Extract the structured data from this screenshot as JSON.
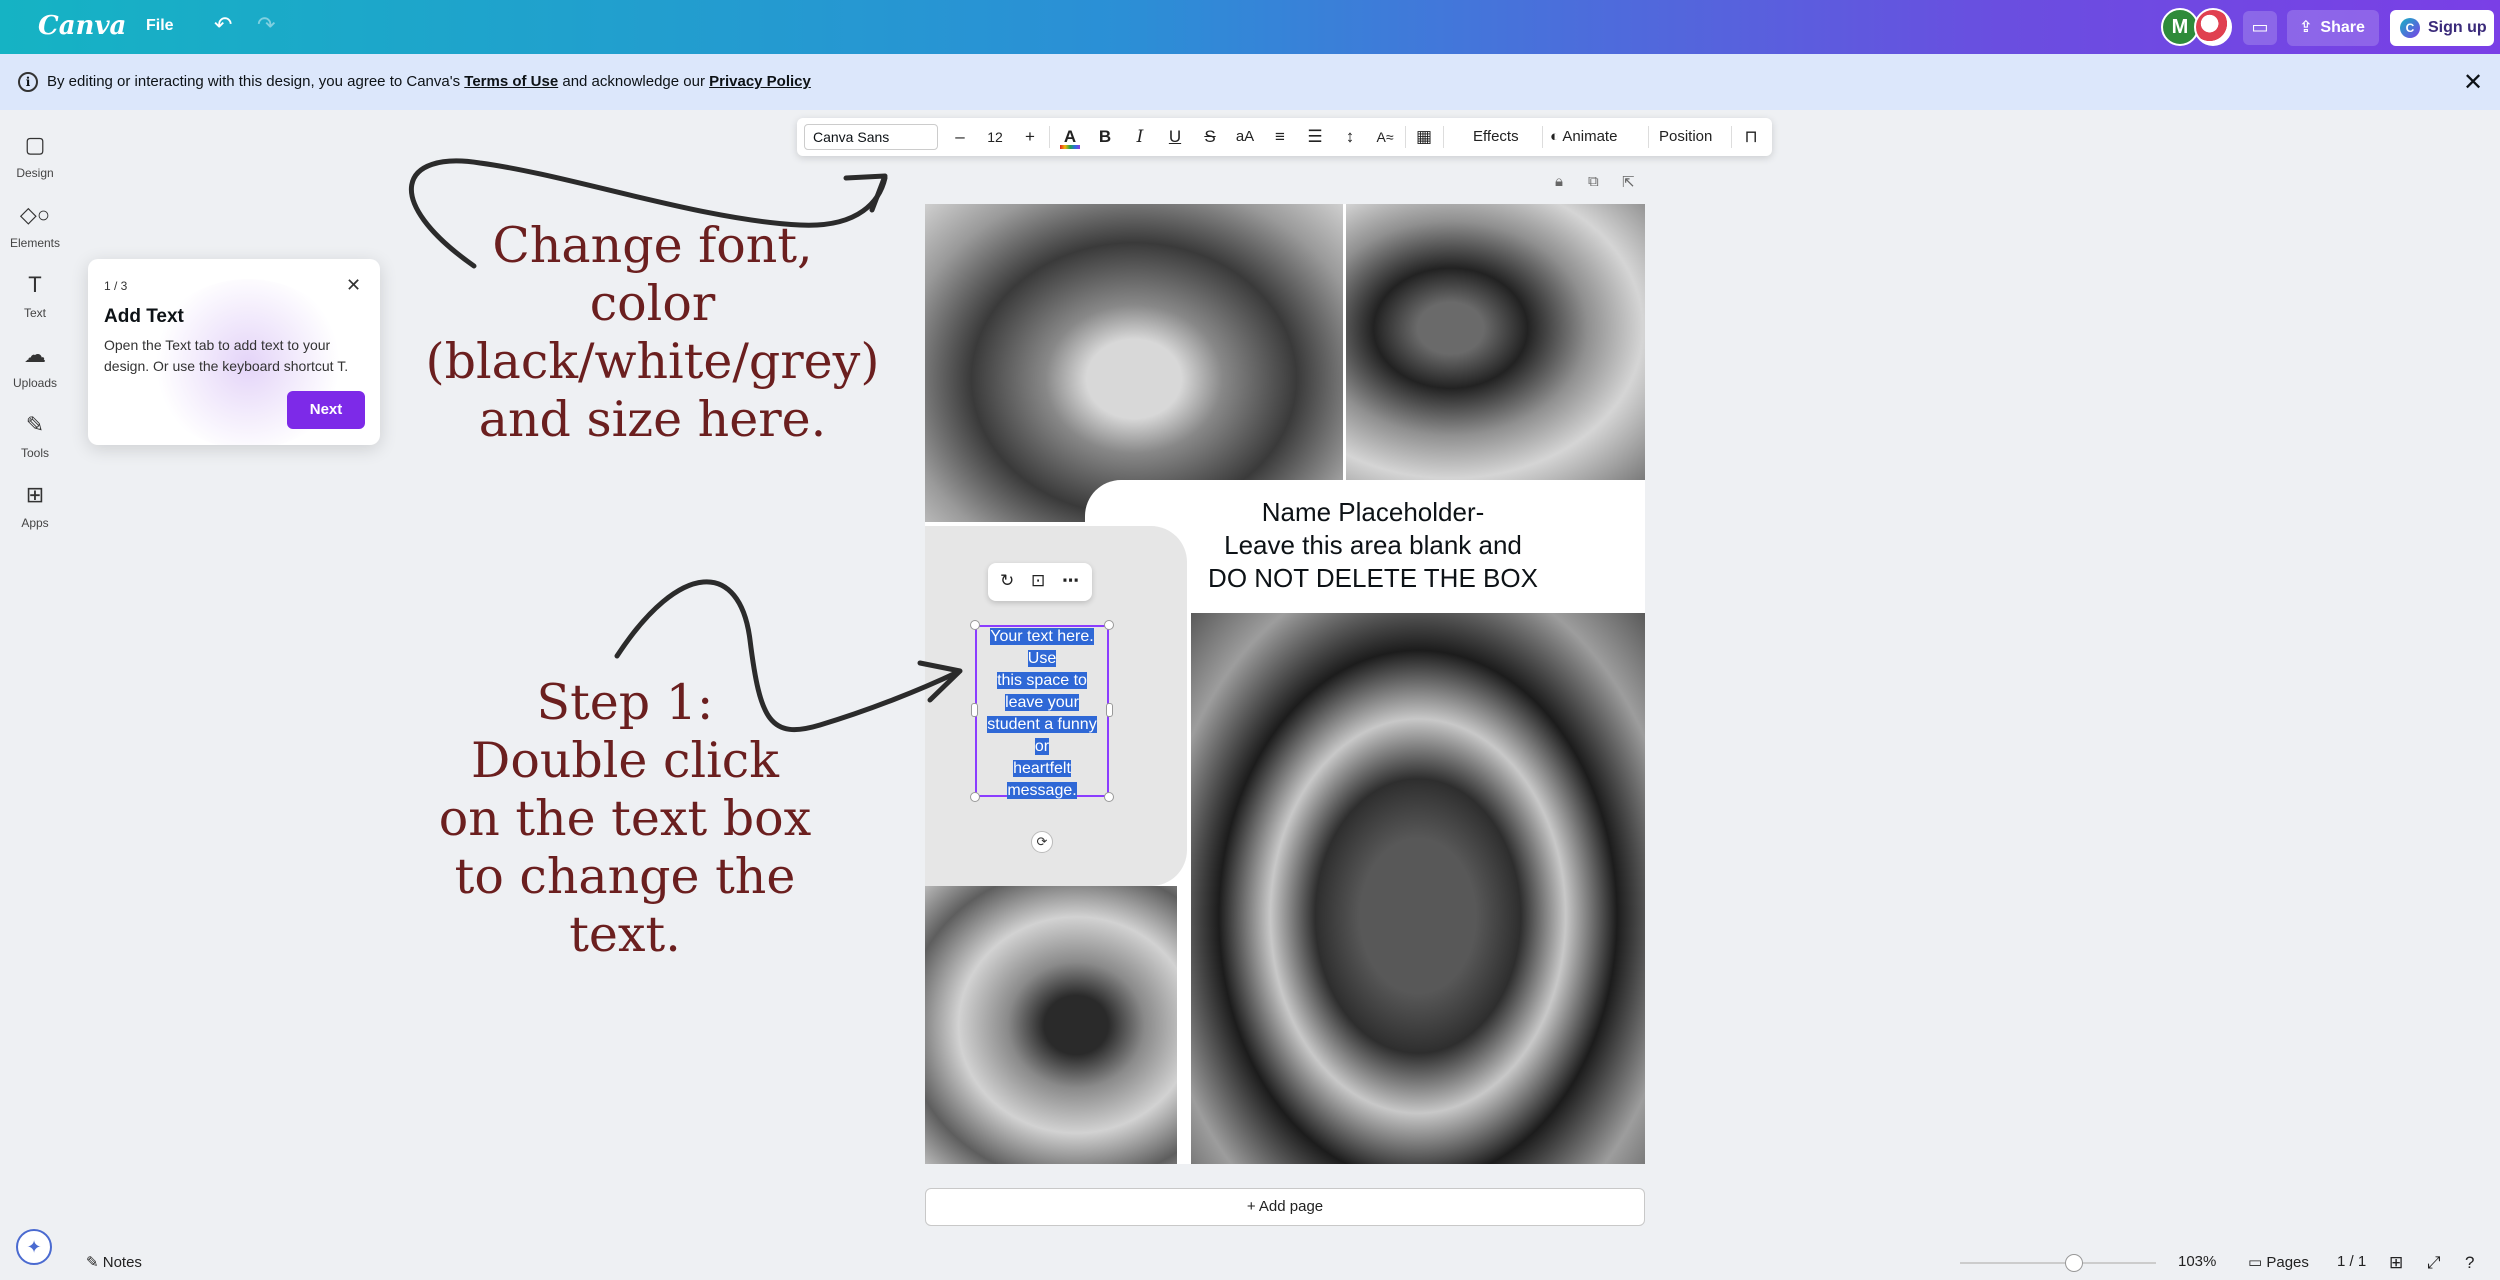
{
  "topbar": {
    "logo": "Canva",
    "file_label": "File",
    "avatar_initial": "M",
    "share_label": "Share",
    "signup_label": "Sign up",
    "signup_logo_letter": "C",
    "accent": "#7d2ae8"
  },
  "notice": {
    "info_glyph": "i",
    "text_before": "By editing or interacting with this design, you agree to Canva's ",
    "terms_link": "Terms of Use",
    "text_middle": " and acknowledge our ",
    "privacy_link": "Privacy Policy"
  },
  "sidebar": {
    "items": [
      {
        "label": "Design",
        "icon": "design-icon"
      },
      {
        "label": "Elements",
        "icon": "elements-icon"
      },
      {
        "label": "Text",
        "icon": "text-icon"
      },
      {
        "label": "Uploads",
        "icon": "uploads-icon"
      },
      {
        "label": "Tools",
        "icon": "tools-icon"
      },
      {
        "label": "Apps",
        "icon": "apps-icon"
      }
    ]
  },
  "tour": {
    "step": "1 / 3",
    "title": "Add Text",
    "description": "Open the Text tab to add text to your design. Or use the keyboard shortcut T.",
    "next_label": "Next"
  },
  "annotations": {
    "font_hint": [
      "Change font,",
      "color (black/white/grey)",
      "and size here."
    ],
    "step_hint": [
      "Step 1:",
      "Double click",
      "on the text box",
      "to change the text."
    ],
    "text_color": "#6b1f1f"
  },
  "toolbar": {
    "font_name": "Canva Sans",
    "font_size": "12",
    "minus": "–",
    "plus": "+",
    "effects_label": "Effects",
    "animate_label": "Animate",
    "position_label": "Position"
  },
  "design": {
    "name_placeholder": [
      "Name Placeholder-",
      "Leave this area blank and",
      "DO NOT DELETE THE BOX"
    ],
    "selected_text": [
      "Your text here.",
      "Use",
      "this space to",
      "leave your",
      "student a funny",
      "or",
      "heartfelt",
      "message."
    ]
  },
  "canvas_footer": {
    "add_page_label": "+ Add page"
  },
  "footer": {
    "notes_label": "Notes",
    "zoom": "103%",
    "zoom_fraction": 0.58,
    "pages_label": "Pages",
    "page_count": "1 / 1"
  }
}
